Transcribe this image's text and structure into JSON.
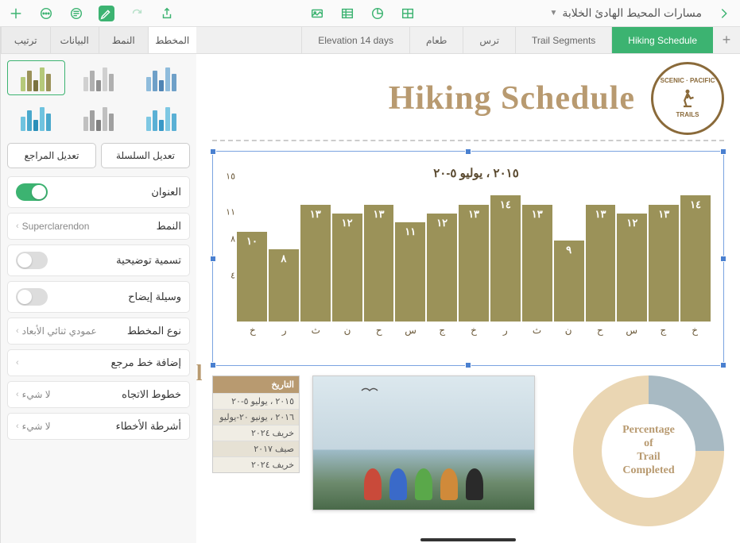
{
  "toolbar": {
    "doc_title": "مسارات المحيط الهادئ الخلابة"
  },
  "sheets": [
    {
      "label": "Hiking Schedule",
      "active": true
    },
    {
      "label": "Trail Segments",
      "active": false
    },
    {
      "label": "ترس",
      "active": false
    },
    {
      "label": "طعام",
      "active": false
    },
    {
      "label": "Elevation 14 days",
      "active": false
    }
  ],
  "inspector_tabs": [
    {
      "label": "المخطط",
      "active": true
    },
    {
      "label": "النمط",
      "active": false
    },
    {
      "label": "البيانات",
      "active": false
    },
    {
      "label": "ترتيب",
      "active": false
    }
  ],
  "thumb_palettes": [
    [
      "#b5c97a",
      "#9b9259",
      "#7a7340"
    ],
    [
      "#d0d0d0",
      "#b0b0b0",
      "#909090"
    ],
    [
      "#8fbcdc",
      "#6fa0c8",
      "#4f84b4"
    ],
    [
      "#6fc3df",
      "#4aa8cc",
      "#2a8fb9"
    ],
    [
      "#c0c0c0",
      "#a0a0a0",
      "#808080"
    ],
    [
      "#7ec8e3",
      "#5ab0d5",
      "#3898c7"
    ]
  ],
  "inspector": {
    "edit_series": "تعديل السلسلة",
    "edit_refs": "تعديل المراجع",
    "title_label": "العنوان",
    "title_on": true,
    "style_label": "النمط",
    "style_value": "Superclarendon",
    "caption_label": "تسمية توضيحية",
    "caption_on": false,
    "legend_label": "وسيلة إيضاح",
    "legend_on": false,
    "type_label": "نوع المخطط",
    "type_value": "عمودي ثنائي الأبعاد",
    "refline_label": "إضافة خط مرجع",
    "trend_label": "خطوط الاتجاه",
    "trend_value": "لا شيء",
    "error_label": "أشرطة الأخطاء",
    "error_value": "لا شيء"
  },
  "page": {
    "title": "Hiking Schedule",
    "logo_top": "SCENIC",
    "logo_side": "PACIFIC",
    "logo_bottom": "TRAILS",
    "donut_text": "Percentage\nof\nTrail\nCompleted",
    "table_header": "التاريخ",
    "table_title_fragment": "ail",
    "table_rows": [
      "٢٠١٥ ، يوليو ٥-٢٠",
      "٢٠١٦ ، يونيو ٢٠-يوليو",
      "خريف ٢٠٢٤",
      "صيف ٢٠١٧",
      "خريف ٢٠٢٤"
    ]
  },
  "chart_data": {
    "type": "bar",
    "title": "٢٠١٥ ، يوليو ٥-٢٠",
    "categories": [
      "خ",
      "ج",
      "س",
      "ح",
      "ن",
      "ث",
      "ر",
      "خ",
      "ج",
      "س",
      "ح",
      "ن",
      "ث",
      "ر",
      "خ"
    ],
    "values": [
      14,
      13,
      12,
      13,
      9,
      13,
      14,
      13,
      12,
      11,
      13,
      12,
      13,
      8,
      10
    ],
    "ylabel": "",
    "y_ticks": [
      4,
      8,
      11,
      15
    ],
    "y_tick_labels": [
      "٤",
      "٨",
      "١١",
      "١٥"
    ],
    "bar_labels": [
      "١٤",
      "١٣",
      "١٢",
      "١٣",
      "٩",
      "١٣",
      "١٤",
      "١٣",
      "١٢",
      "١١",
      "١٣",
      "١٢",
      "١٣",
      "٨",
      "١٠"
    ],
    "ylim": [
      0,
      15
    ]
  },
  "people_colors": [
    "#c94a3a",
    "#3a6ac9",
    "#5aa84a",
    "#d08a3a",
    "#2a2a2a"
  ]
}
